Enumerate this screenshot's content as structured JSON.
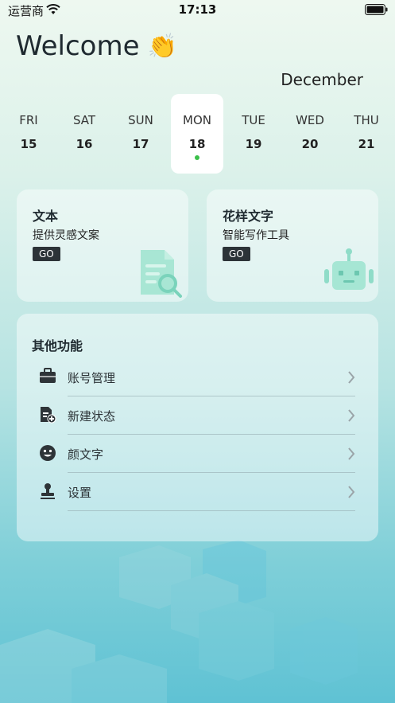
{
  "status_bar": {
    "carrier": "运营商",
    "time": "17:13"
  },
  "header": {
    "welcome": "Welcome",
    "clap_emoji": "👏",
    "month": "December"
  },
  "week": [
    {
      "dow": "FRI",
      "date": "15"
    },
    {
      "dow": "SAT",
      "date": "16"
    },
    {
      "dow": "SUN",
      "date": "17"
    },
    {
      "dow": "MON",
      "date": "18"
    },
    {
      "dow": "TUE",
      "date": "19"
    },
    {
      "dow": "WED",
      "date": "20"
    },
    {
      "dow": "THU",
      "date": "21"
    }
  ],
  "selected_day_index": 3,
  "cards": [
    {
      "title": "文本",
      "subtitle": "提供灵感文案",
      "button": "GO",
      "icon": "document-search-icon"
    },
    {
      "title": "花样文字",
      "subtitle": "智能写作工具",
      "button": "GO",
      "icon": "robot-icon"
    }
  ],
  "panel": {
    "title": "其他功能",
    "items": [
      {
        "label": "账号管理",
        "icon": "briefcase-icon"
      },
      {
        "label": "新建状态",
        "icon": "new-document-icon"
      },
      {
        "label": "颜文字",
        "icon": "smiley-icon"
      },
      {
        "label": "设置",
        "icon": "stamp-icon"
      }
    ]
  },
  "colors": {
    "accent_dot": "#3bc04a",
    "button_bg": "#2c3338",
    "illustration": "#8fdcc8"
  }
}
